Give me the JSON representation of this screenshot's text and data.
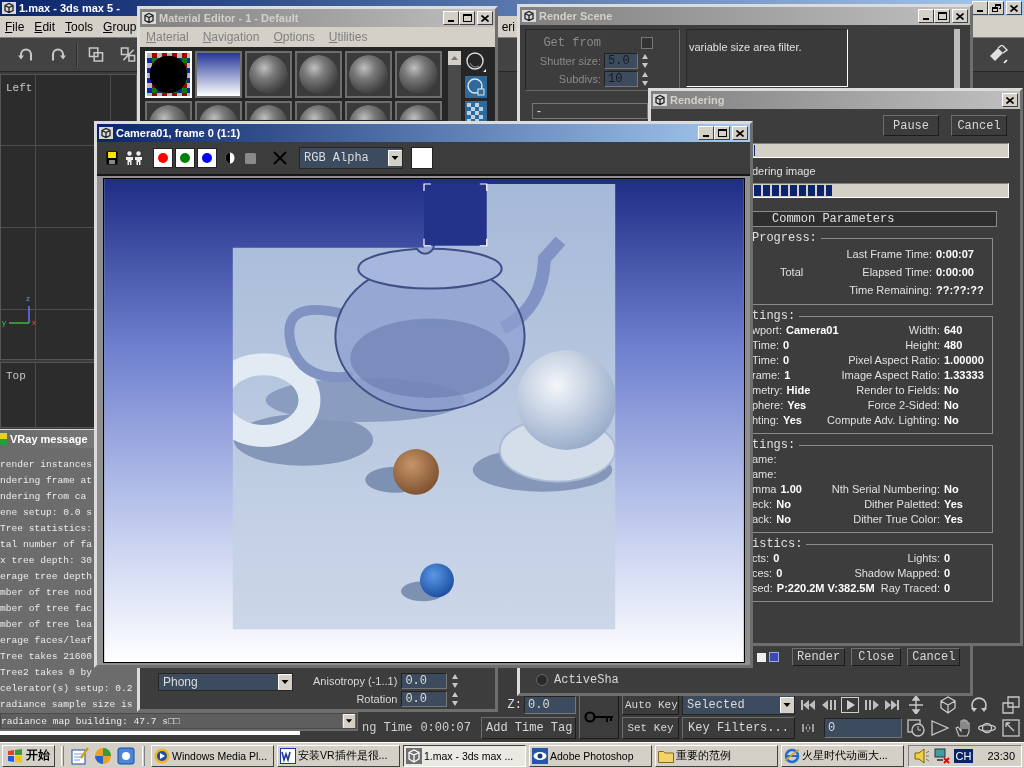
{
  "app_window": {
    "title": "1.max - 3ds max 5 -",
    "menu": [
      "File",
      "Edit",
      "Tools",
      "Group"
    ],
    "menu_cut": "eri",
    "viewports": [
      {
        "label": "Left"
      },
      {
        "label": "Top"
      }
    ],
    "axis_labels": [
      "z",
      "y",
      "x"
    ],
    "time_controls": {
      "time_label": "ng Time",
      "time_value": "0:00:07",
      "add_time_tag": "Add Time Tag",
      "z_label": "Z:",
      "z_value": "0.0",
      "auto_key": "Auto Key",
      "set_key": "Set Key",
      "key_mode": "Selected",
      "key_filters": "Key Filters...",
      "frame": "0"
    }
  },
  "material_editor": {
    "title": "Material Editor - 1 - Default",
    "menu": [
      "Material",
      "Navigation",
      "Options",
      "Utilities"
    ],
    "slots": [
      {
        "kind": "checker",
        "selected": true
      },
      {
        "kind": "gradient",
        "selected": false
      },
      {
        "kind": "sphere",
        "selected": false
      },
      {
        "kind": "sphere",
        "selected": false
      },
      {
        "kind": "sphere",
        "selected": false
      },
      {
        "kind": "sphere",
        "selected": false
      },
      {
        "kind": "sphere",
        "selected": false
      },
      {
        "kind": "sphere",
        "selected": false
      },
      {
        "kind": "sphere",
        "selected": false
      },
      {
        "kind": "sphere",
        "selected": false
      },
      {
        "kind": "sphere",
        "selected": false
      },
      {
        "kind": "sphere",
        "selected": false
      }
    ],
    "shader": "Phong",
    "params": [
      {
        "label": "Anisotropy (-1..1)",
        "value": "0.0"
      },
      {
        "label": "Rotation",
        "value": "0.0"
      }
    ]
  },
  "render_scene": {
    "title": "Render Scene",
    "get_from": {
      "label": "Get from",
      "disabled": true,
      "checked": false
    },
    "spinners": [
      {
        "label": "Shutter size:",
        "value": "5.0",
        "disabled": true
      },
      {
        "label": "Subdivs:",
        "value": "10",
        "disabled": true
      }
    ],
    "rollout": "-",
    "description": "variable size area filter.",
    "option_checkbox": {
      "checked": false
    },
    "buttons": [
      "Render",
      "Close",
      "Cancel"
    ],
    "active_shade": {
      "label": "ActiveSha",
      "selected": false
    }
  },
  "rendering": {
    "title": "Rendering",
    "buttons": [
      "Pause",
      "Cancel"
    ],
    "bars": [
      {
        "level": 0
      },
      {
        "label": "dering image",
        "level": 0.31
      }
    ],
    "rollout": "Common Parameters",
    "groups": [
      {
        "kind": "progress",
        "title": "Progress:",
        "rows": [
          {
            "right_label": "Last Frame Time:",
            "right_value": "0:00:07"
          },
          {
            "left_label": "Total",
            "right_label": "Elapsed Time:",
            "right_value": "0:00:00"
          },
          {
            "right_label": "Time Remaining:",
            "right_value": "??:??:??"
          }
        ]
      },
      {
        "kind": "settings",
        "title": "tings:",
        "rows": [
          {
            "left_label": "wport:",
            "left_value": "Camera01",
            "right_label": "Width:",
            "right_value": "640"
          },
          {
            "left_label": "Time:",
            "left_value": "0",
            "right_label": "Height:",
            "right_value": "480"
          },
          {
            "left_label": "Time:",
            "left_value": "0",
            "right_label": "Pixel Aspect Ratio:",
            "right_value": "1.00000"
          },
          {
            "left_label": "rame:",
            "left_value": "1",
            "right_label": "Image Aspect Ratio:",
            "right_value": "1.33333"
          },
          {
            "left_label": "metry:",
            "left_value": "Hide",
            "right_label": "Render to Fields:",
            "right_value": "No"
          },
          {
            "left_label": "phere:",
            "left_value": "Yes",
            "right_label": "Force 2-Sided:",
            "right_value": "No"
          },
          {
            "left_label": "hting:",
            "left_value": "Yes",
            "right_label": "Compute Adv. Lighting:",
            "right_value": "No"
          }
        ]
      },
      {
        "kind": "settings",
        "title": "tings:",
        "rows": [
          {
            "left_label": "ame:"
          },
          {
            "left_label": "ame:"
          },
          {
            "left_label": "mma",
            "left_value": "1.00",
            "right_label": "Nth Serial Numbering:",
            "right_value": "No"
          },
          {
            "left_label": "eck:",
            "left_value": "No",
            "right_label": "Dither Paletted:",
            "right_value": "Yes"
          },
          {
            "left_label": "ack:",
            "left_value": "No",
            "right_label": "Dither True Color:",
            "right_value": "Yes"
          }
        ]
      },
      {
        "kind": "settings",
        "title": "istics:",
        "rows": [
          {
            "left_label": "cts:",
            "left_value": "0",
            "right_label": "Lights:",
            "right_value": "0"
          },
          {
            "left_label": "ces:",
            "left_value": "0",
            "right_label": "Shadow Mapped:",
            "right_value": "0"
          },
          {
            "left_label": "sed:",
            "left_value": "P:220.2M V:382.5M",
            "right_label": "Ray Traced:",
            "right_value": "0"
          }
        ]
      }
    ]
  },
  "frame_window": {
    "title": "Camera01, frame 0 (1:1)",
    "channels": [
      {
        "color": "#ff0000",
        "on": true
      },
      {
        "color": "#008000",
        "on": true
      },
      {
        "color": "#0000ff",
        "on": true
      }
    ],
    "display": "RGB Alpha"
  },
  "vray_messages": {
    "title": "VRay message",
    "lines": [
      "render instances",
      "ndering frame at",
      "ndering from ca",
      "ene setup: 0.0 s",
      "Tree statistics:",
      "tal number of fa",
      "x tree depth: 30",
      "erage tree depth",
      "mber of tree nod",
      "mber of tree fac",
      "mber of tree lea",
      "erage faces/leaf",
      "Tree takes 21600",
      "Tree2 takes 0 by",
      "celerator(s) setup: 0.2",
      "radiance sample size is",
      "radiance map building: 47.7 s□□"
    ]
  },
  "taskbar": {
    "start": "开始",
    "tasks": [
      {
        "kind": "media",
        "label": "Windows Media Pl...",
        "selected": false
      },
      {
        "kind": "document",
        "label": "安装VR插件是很...",
        "selected": false
      },
      {
        "kind": "max",
        "label": "1.max - 3ds max ...",
        "selected": true
      },
      {
        "kind": "image",
        "label": "Adobe Photoshop",
        "selected": false
      },
      {
        "kind": "folder",
        "label": "重要的范例",
        "selected": false
      },
      {
        "kind": "browser",
        "label": "火星时代动画大...",
        "selected": false
      }
    ],
    "ime": "CH",
    "clock": "23:30"
  }
}
